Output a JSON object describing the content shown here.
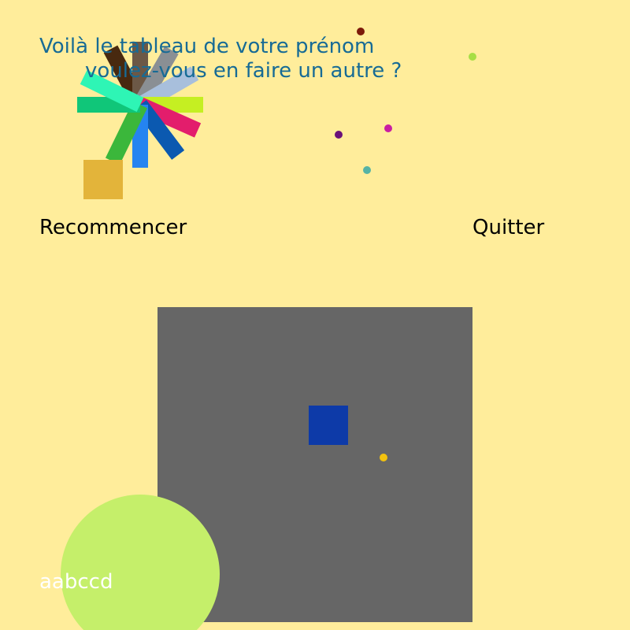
{
  "colors": {
    "background": "#ffed9b",
    "title_text": "#176b95",
    "action_text": "#000000",
    "name_text": "#ffffff",
    "canvas": "#666666"
  },
  "title": {
    "line1": "Voilà le tableau de votre prénom",
    "line2": "voulez-vous en faire un autre ?"
  },
  "actions": {
    "restart": "Recommencer",
    "quit": "Quitter"
  },
  "name_label": "aabccd",
  "artwork": {
    "burst_colors": [
      "#48290f",
      "#6c5846",
      "#8a8f94",
      "#a8bfdc",
      "#c5ef22",
      "#e31d6c",
      "#0b59b0",
      "#2584f0",
      "#3bb73b",
      "#10c679",
      "#2ef5b5"
    ],
    "square_colors": [
      "#e3b43a",
      "#0d3aa8"
    ],
    "circle_color": "#c5ef6a",
    "dot_colors": [
      "#7c1a0a",
      "#a7de44",
      "#c91ea2",
      "#6a1179",
      "#56b3a5",
      "#f2c20f"
    ]
  }
}
